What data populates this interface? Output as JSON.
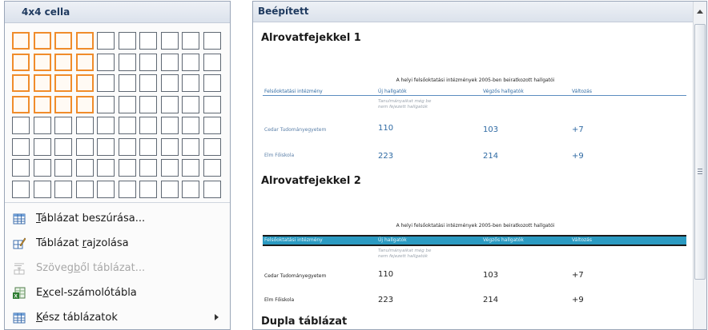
{
  "left_panel": {
    "title": "4x4 cella",
    "grid": {
      "columns": 10,
      "rows": 8,
      "selected_columns": 4,
      "selected_rows": 4
    },
    "menu": [
      {
        "icon": "insert-table-icon",
        "pre": "",
        "u": "T",
        "post": "áblázat beszúrása...",
        "enabled": true
      },
      {
        "icon": "draw-table-icon",
        "pre": "Táblázat ",
        "u": "r",
        "post": "ajzolása",
        "enabled": true
      },
      {
        "icon": "text-to-table-icon",
        "pre": "Szöveg",
        "u": "b",
        "post": "ől táblázat...",
        "enabled": false
      },
      {
        "icon": "excel-sheet-icon",
        "pre": "E",
        "u": "x",
        "post": "cel-számolótábla",
        "enabled": true
      },
      {
        "icon": "quick-tables-icon",
        "pre": "",
        "u": "K",
        "post": "ész táblázatok",
        "enabled": true,
        "submenu": true
      }
    ]
  },
  "right_panel": {
    "title": "Beépített",
    "sections": [
      {
        "heading": "Alrovatfejekkel 1",
        "table_title": "A helyi felsőoktatási intézmények 2005-ben beiratkozott hallgatói",
        "headers": [
          "Felsőoktatási intézmény",
          "Új hallgatók",
          "Végzős hallgatók",
          "Változás"
        ],
        "subheader": "Tanulmányaikat még be nem fejezett hallgatók",
        "rows": [
          {
            "name": "Cedar Tudományegyetem",
            "new": "110",
            "grad": "103",
            "change": "+7"
          },
          {
            "name": "Elm Főiskola",
            "new": "223",
            "grad": "214",
            "change": "+9"
          }
        ]
      },
      {
        "heading": "Alrovatfejekkel 2",
        "table_title": "A helyi felsőoktatási intézmények 2005-ben beiratkozott hallgatói",
        "headers": [
          "Felsőoktatási intézmény",
          "Új hallgatók",
          "Végzős hallgatók",
          "Változás"
        ],
        "subheader": "Tanulmányaikat még be nem fejezett hallgatók",
        "rows": [
          {
            "name": "Cedar Tudományegyetem",
            "new": "110",
            "grad": "103",
            "change": "+7"
          },
          {
            "name": "Elm Főiskola",
            "new": "223",
            "grad": "214",
            "change": "+9"
          }
        ]
      },
      {
        "heading": "Dupla táblázat"
      }
    ]
  },
  "colors": {
    "grid_selected": "#f08c2b",
    "header_bar": "#2b9ac1",
    "table_text": "#2f6aa3"
  }
}
